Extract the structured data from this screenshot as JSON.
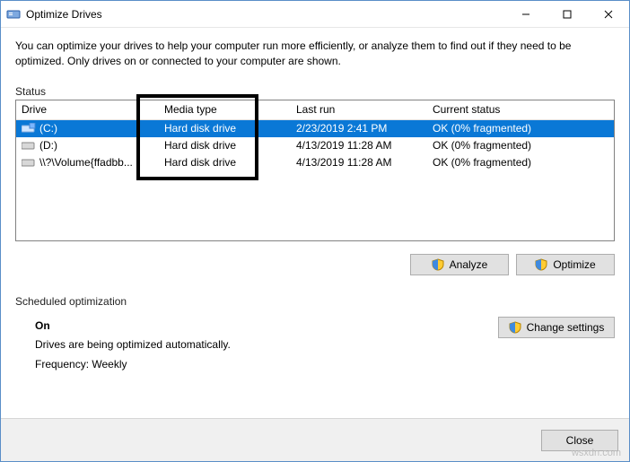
{
  "window": {
    "title": "Optimize Drives",
    "description": "You can optimize your drives to help your computer run more efficiently, or analyze them to find out if they need to be optimized. Only drives on or connected to your computer are shown."
  },
  "status": {
    "label": "Status",
    "columns": {
      "drive": "Drive",
      "media": "Media type",
      "last": "Last run",
      "status": "Current status"
    },
    "rows": [
      {
        "drive": "(C:)",
        "media": "Hard disk drive",
        "last": "2/23/2019 2:41 PM",
        "status": "OK (0% fragmented)",
        "selected": true,
        "icon": "os-drive-icon"
      },
      {
        "drive": "(D:)",
        "media": "Hard disk drive",
        "last": "4/13/2019 11:28 AM",
        "status": "OK (0% fragmented)",
        "selected": false,
        "icon": "drive-icon"
      },
      {
        "drive": "\\\\?\\Volume{ffadbb...",
        "media": "Hard disk drive",
        "last": "4/13/2019 11:28 AM",
        "status": "OK (0% fragmented)",
        "selected": false,
        "icon": "drive-icon"
      }
    ],
    "buttons": {
      "analyze": "Analyze",
      "optimize": "Optimize"
    }
  },
  "scheduled": {
    "label": "Scheduled optimization",
    "state": "On",
    "line1": "Drives are being optimized automatically.",
    "line2": "Frequency: Weekly",
    "change": "Change settings"
  },
  "footer": {
    "close": "Close"
  },
  "watermark": "wsxdn.com"
}
